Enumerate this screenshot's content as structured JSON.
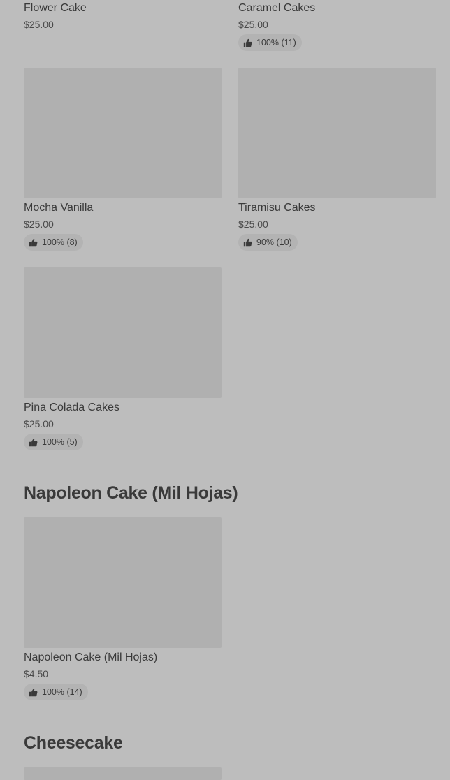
{
  "items": [
    {
      "name": "Flower Cake",
      "price": "$25.00"
    },
    {
      "name": "Caramel Cakes",
      "price": "$25.00",
      "rating": "100% (11)"
    },
    {
      "name": "Mocha Vanilla",
      "price": "$25.00",
      "rating": "100% (8)"
    },
    {
      "name": "Tiramisu Cakes",
      "price": "$25.00",
      "rating": "90% (10)"
    },
    {
      "name": "Pina Colada Cakes",
      "price": "$25.00",
      "rating": "100% (5)"
    }
  ],
  "sections": [
    {
      "title": "Napoleon Cake (Mil Hojas)",
      "items": [
        {
          "name": "Napoleon Cake (Mil Hojas)",
          "price": "$4.50",
          "rating": "100% (14)"
        }
      ]
    },
    {
      "title": "Cheesecake",
      "items": []
    }
  ],
  "icons": {
    "rating": "thumbs-up-icon"
  }
}
